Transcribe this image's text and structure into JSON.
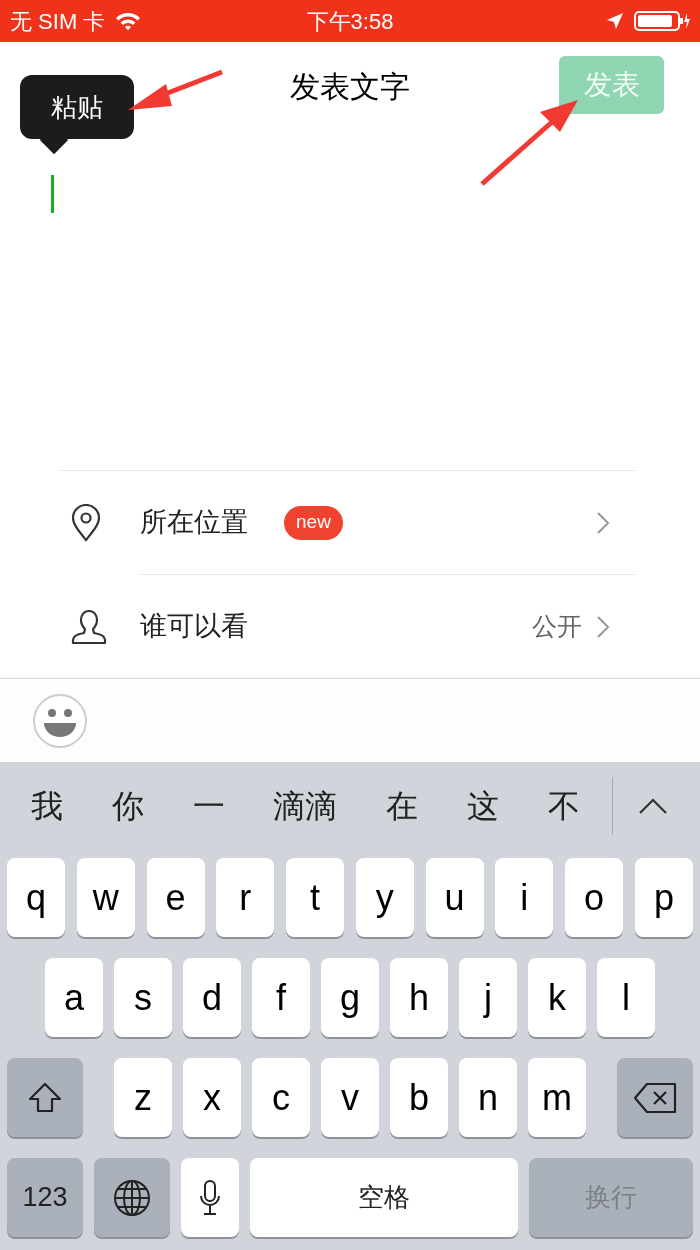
{
  "status_bar": {
    "carrier": "无 SIM 卡",
    "time": "下午3:58"
  },
  "header": {
    "title": "发表文字",
    "post_button": {
      "label": "发表",
      "disabled": true
    }
  },
  "paste_popup": {
    "label": "粘贴"
  },
  "options": [
    {
      "kind": "location",
      "label": "所在位置",
      "badge": "new"
    },
    {
      "kind": "visibility",
      "label": "谁可以看",
      "value": "公开"
    }
  ],
  "keyboard": {
    "candidates": [
      "我",
      "你",
      "一",
      "滴滴",
      "在",
      "这",
      "不"
    ],
    "rows": [
      [
        "q",
        "w",
        "e",
        "r",
        "t",
        "y",
        "u",
        "i",
        "o",
        "p"
      ],
      [
        "a",
        "s",
        "d",
        "f",
        "g",
        "h",
        "j",
        "k",
        "l"
      ],
      [
        "z",
        "x",
        "c",
        "v",
        "b",
        "n",
        "m"
      ]
    ],
    "number_key": "123",
    "space_key": "空格",
    "return_key": {
      "label": "换行",
      "disabled": true
    }
  }
}
